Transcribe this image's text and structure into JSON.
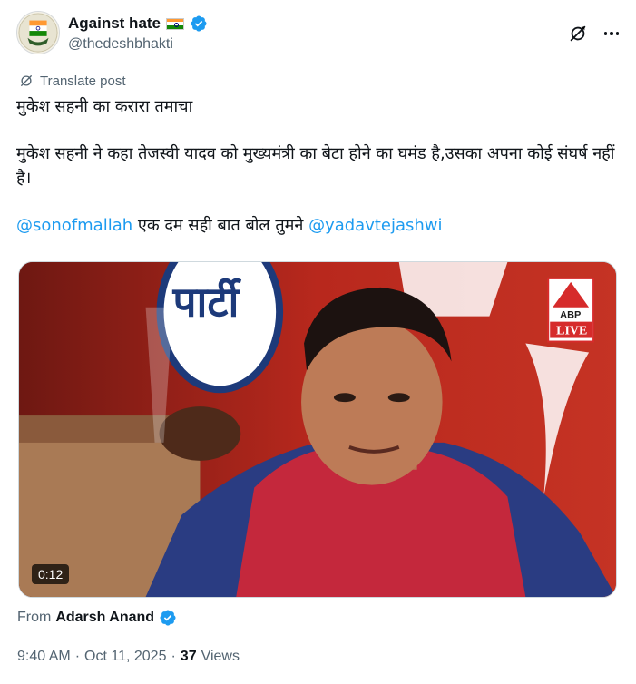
{
  "author": {
    "display_name": "Against hate",
    "handle": "@thedeshbhakti",
    "flag_icon": "india-flag-icon",
    "verified_icon": "verified-badge-icon",
    "verified_color": "#1d9bf0"
  },
  "actions": {
    "grok_icon": "grok-icon",
    "more_icon": "more-options-icon"
  },
  "translate_label": "Translate post",
  "tweet": {
    "line1": "मुकेश सहनी का करारा तमाचा",
    "line2": "मुकेश सहनी ने कहा तेजस्वी यादव को मुख्यमंत्री का बेटा होने का घमंड है,उसका अपना कोई संघर्ष नहीं है।",
    "mention1": "@sonofmallah",
    "line3_middle": " एक दम सही बात बोल तुमने ",
    "mention2": "@yadavtejashwi",
    "mention_color": "#1d9bf0"
  },
  "media": {
    "duration": "0:12",
    "logo_text_top": "ABP",
    "logo_text_bottom": "LIVE",
    "banner_text": "पार्टी"
  },
  "from": {
    "label": "From",
    "name": "Adarsh Anand"
  },
  "meta": {
    "time": "9:40 AM",
    "separator1": "·",
    "date": "Oct 11, 2025",
    "separator2": "·",
    "views_count": "37",
    "views_label": "Views"
  }
}
